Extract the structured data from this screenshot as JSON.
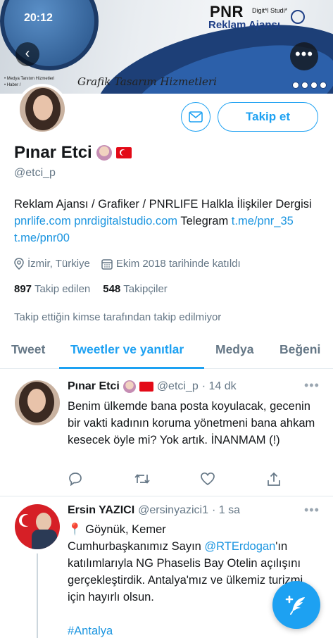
{
  "status_bar": {
    "time": "20:12"
  },
  "banner": {
    "brand": "PNR",
    "brand_sub": "Digit*l Studi*",
    "brand_line2": "Reklam Ajansı",
    "tagline": "Grafik Tasarım Hizmetleri",
    "bullets": [
      "• Medya Tanıtım Hizmetleri",
      "• Haber /"
    ]
  },
  "profile": {
    "name": "Pınar Etci",
    "handle": "@etci_p",
    "follow_label": "Takip et",
    "bio_text_1": "Reklam Ajansı / Grafiker / PNRLIFE Halkla İlişkiler Dergisi ",
    "bio_link_1": "pnrlife.com",
    "bio_link_2": "pnrdigitalstudio.com",
    "bio_text_2": " Telegram ",
    "bio_link_3": "t.me/pnr_35",
    "bio_link_4": "t.me/pnr00",
    "location": "İzmir, Türkiye",
    "joined": "Ekim 2018 tarihinde katıldı",
    "following_count": "897",
    "following_label": "Takip edilen",
    "followers_count": "548",
    "followers_label": "Takipçiler",
    "not_followed": "Takip ettiğin kimse tarafından takip edilmiyor"
  },
  "tabs": [
    {
      "label": "Tweet"
    },
    {
      "label": "Tweetler ve yanıtlar"
    },
    {
      "label": "Medya"
    },
    {
      "label": "Beğeni"
    }
  ],
  "tweets": [
    {
      "name": "Pınar Etci",
      "handle": "@etci_p",
      "time": "· 14 dk",
      "text": "Benim ülkemde bana posta koyulacak, gecenin bir vakti kadının koruma yönetmeni bana ahkam kesecek öyle mi? Yok artık. İNANMAM (!)"
    },
    {
      "name": "Ersin YAZICI",
      "handle": "@ersinyazici1",
      "time": "· 1 sa",
      "line1": "📍 Göynük, Kemer",
      "text_a": "Cumhurbaşkanımız Sayın ",
      "mention": "@RTErdogan",
      "text_b": "'ın katılımlarıyla NG Phaselis Bay Otelin açılışını gerçekleştirdik. Antalya'mız ve ülkemiz turizmi için hayırlı olsun.",
      "hashtag": "#Antalya"
    }
  ],
  "colors": {
    "accent": "#1da1f2",
    "muted": "#657786",
    "link": "#1b95e0"
  }
}
